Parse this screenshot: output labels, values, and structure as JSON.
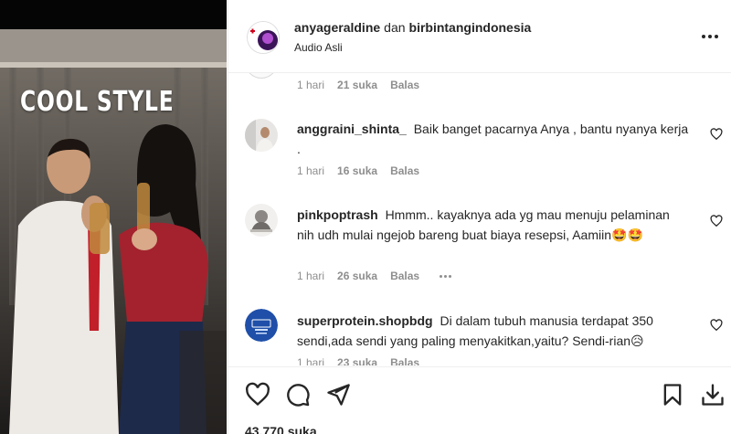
{
  "video": {
    "caption": "COOL STYLE"
  },
  "header": {
    "author": "anyageraldine",
    "connector": "dan",
    "collaborator": "birbintangindonesia",
    "audio": "Audio Asli",
    "more_icon": "more-horizontal-icon"
  },
  "comments": [
    {
      "username": "",
      "text": "",
      "time": "1 hari",
      "likes": "21 suka",
      "reply": "Balas"
    },
    {
      "username": "anggraini_shinta_",
      "text": "Baik banget pacarnya Anya , bantu nyanya kerja .",
      "time": "1 hari",
      "likes": "16 suka",
      "reply": "Balas"
    },
    {
      "username": "pinkpoptrash",
      "text": "Hmmm.. kayaknya ada yg mau menuju pelaminan nih udh mulai ngejob bareng buat biaya resepsi, Aamiin",
      "emoji": "🤩🤩",
      "time": "1 hari",
      "likes": "26 suka",
      "reply": "Balas"
    },
    {
      "username": "superprotein.shopbdg",
      "text": "Di dalam tubuh manusia terdapat 350 sendi,ada sendi yang paling menyakitkan,yaitu? Sendi-rian",
      "emoji": "😥",
      "time": "1 hari",
      "likes": "23 suka",
      "reply": "Balas"
    }
  ],
  "actions": {
    "like_icon": "heart-icon",
    "comment_icon": "comment-icon",
    "share_icon": "send-icon",
    "save_icon": "bookmark-icon",
    "download_icon": "download-icon",
    "likes_count": "43.770 suka"
  },
  "colors": {
    "text": "#262626",
    "muted": "#8e8e8e",
    "divider": "#efefef",
    "superprotein_blue": "#1f4fa8"
  }
}
